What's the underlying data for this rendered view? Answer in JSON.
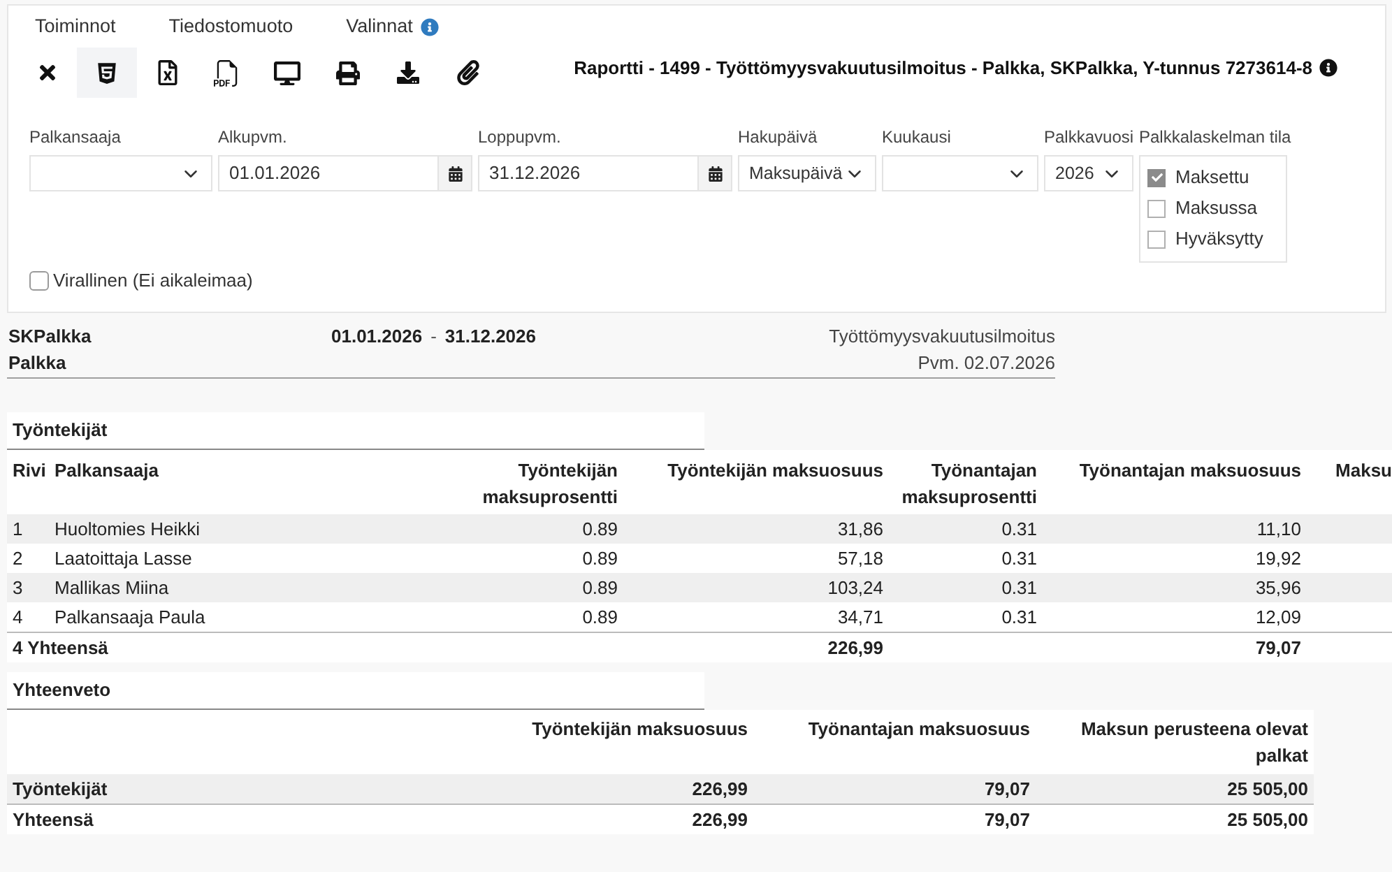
{
  "menu": [
    {
      "label": "Toiminnot",
      "kind": "plain"
    },
    {
      "label": "Tiedostomuoto",
      "kind": "plain"
    },
    {
      "label": "Valinnat",
      "kind": "info"
    }
  ],
  "toolbar": [
    {
      "kind": "close",
      "selected": false
    },
    {
      "kind": "html",
      "selected": true
    },
    {
      "kind": "spreadsheet",
      "selected": false
    },
    {
      "kind": "pdf",
      "selected": false
    },
    {
      "kind": "screen",
      "selected": false
    },
    {
      "kind": "print",
      "selected": false
    },
    {
      "kind": "download",
      "selected": false
    },
    {
      "kind": "attach",
      "selected": false
    }
  ],
  "report_title": "Raportti - 1499 - Työttömyysvakuutusilmoitus - Palkka, SKPalkka, Y-tunnus 7273614-8",
  "filters": [
    {
      "kind": "select",
      "label": "Palkansaaja"
    },
    {
      "kind": "date",
      "label": "Alkupvm.",
      "value": "01.01.2026"
    },
    {
      "kind": "date",
      "label": "Loppupvm.",
      "value": "31.12.2026"
    },
    {
      "kind": "select",
      "label": "Hakupäivä",
      "value": "Maksupäivä"
    },
    {
      "kind": "select",
      "label": "Kuukausi"
    },
    {
      "kind": "select",
      "label": "Palkkavuosi",
      "value": "2026"
    },
    {
      "kind": "checklist",
      "label": "Palkkalaskelman tila",
      "options": [
        {
          "label": "Maksettu",
          "checked": true
        },
        {
          "label": "Maksussa",
          "checked": false
        },
        {
          "label": "Hyväksytty",
          "checked": false
        }
      ]
    }
  ],
  "official": {
    "label": "Virallinen (Ei aikaleimaa)",
    "checked": false
  },
  "report_header": {
    "company": "SKPalkka",
    "type": "Palkka",
    "start_date": "01.01.2026",
    "separator": "-",
    "end_date": "31.12.2026",
    "report_name": "Työttömyysvakuutusilmoitus",
    "print_date": "Pvm. 02.07.2026"
  },
  "employees": {
    "title": "Työntekijät",
    "columns": [
      "Rivi",
      "Palkansaaja",
      "Työntekijän maksuprosentti",
      "Työntekijän maksuosuus",
      "Työnantajan maksuprosentti",
      "Työnantajan maksuosuus",
      "Maksu"
    ],
    "rows": [
      [
        "1",
        "Huoltomies Heikki",
        "0.89",
        "31,86",
        "0.31",
        "11,10"
      ],
      [
        "2",
        "Laatoittaja Lasse",
        "0.89",
        "57,18",
        "0.31",
        "19,92"
      ],
      [
        "3",
        "Mallikas Miina",
        "0.89",
        "103,24",
        "0.31",
        "35,96"
      ],
      [
        "4",
        "Palkansaaja Paula",
        "0.89",
        "34,71",
        "0.31",
        "12,09"
      ]
    ],
    "total": {
      "label": "4 Yhteensä",
      "employee_share": "226,99",
      "employer_share": "79,07"
    }
  },
  "summary": {
    "title": "Yhteenveto",
    "columns": [
      "Työntekijän maksuosuus",
      "Työnantajan maksuosuus",
      "Maksun perusteena olevat palkat"
    ],
    "rows": [
      {
        "kind": "row",
        "label": "Työntekijät",
        "cells": [
          "226,99",
          "79,07",
          "25 505,00"
        ]
      },
      {
        "kind": "total",
        "label": "Yhteensä",
        "cells": [
          "226,99",
          "79,07",
          "25 505,00"
        ]
      }
    ]
  }
}
